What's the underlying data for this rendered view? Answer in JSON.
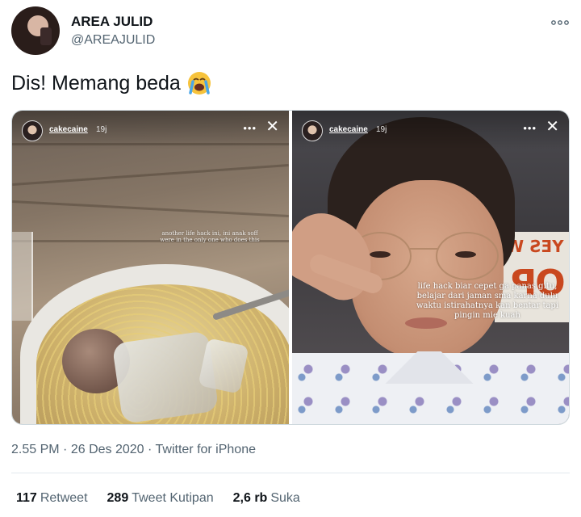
{
  "author": {
    "name": "AREA JULID",
    "handle": "@AREAJULID"
  },
  "tweet": {
    "text": "Dis! Memang beda",
    "emoji": "loudly-crying-face"
  },
  "media": {
    "left_story": {
      "username": "cakecaine",
      "time": "19j",
      "caption": "another life hack ini, ini anak soff were in the only one who does this"
    },
    "right_story": {
      "username": "cakecaine",
      "time": "19j",
      "caption": "life hack biar cepet ga panas gitu, belajar dari jaman sma karna dulu waktu istirahatnya kan bentar tapi pingin mie kuah",
      "sign_small": "YES W",
      "sign_big": "OP"
    }
  },
  "meta": {
    "time": "2.55 PM",
    "date": "26 Des 2020",
    "source": "Twitter for iPhone"
  },
  "stats": {
    "retweets_count": "117",
    "retweets_label": "Retweet",
    "quotes_count": "289",
    "quotes_label": "Tweet Kutipan",
    "likes_count": "2,6 rb",
    "likes_label": "Suka"
  },
  "colors": {
    "text": "#0f1419",
    "secondary": "#536471",
    "divider": "#e1e8ed"
  }
}
